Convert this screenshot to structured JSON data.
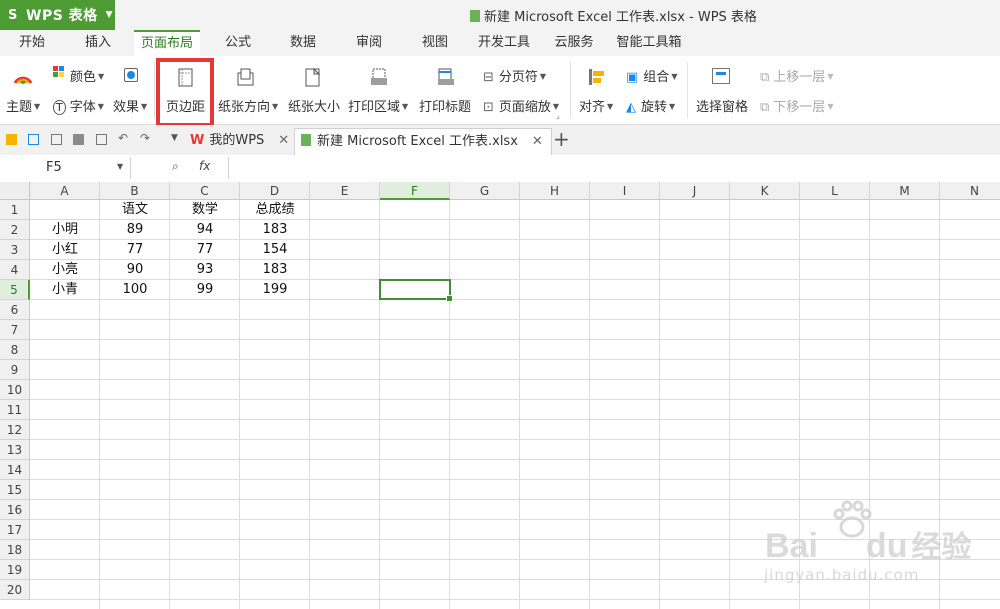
{
  "app": {
    "name": "WPS 表格",
    "logo": "S"
  },
  "window_title": "新建 Microsoft Excel 工作表.xlsx - WPS 表格",
  "menu_tabs": [
    "开始",
    "插入",
    "页面布局",
    "公式",
    "数据",
    "审阅",
    "视图",
    "开发工具",
    "云服务",
    "智能工具箱"
  ],
  "active_tab": "页面布局",
  "ribbon": {
    "theme": "主题",
    "colors": "颜色",
    "fonts": "字体",
    "effects": "效果",
    "margins": "页边距",
    "orientation": "纸张方向",
    "size": "纸张大小",
    "print_area": "打印区域",
    "print_titles": "打印标题",
    "breaks": "分页符",
    "scale": "页面缩放",
    "align": "对齐",
    "group": "组合",
    "rotate": "旋转",
    "selection_pane": "选择窗格",
    "bring_forward": "上移一层",
    "send_backward": "下移一层"
  },
  "doc_tabs": {
    "home": "我的WPS",
    "file": "新建 Microsoft Excel 工作表.xlsx",
    "add": "+"
  },
  "formula_bar": {
    "name_box": "F5",
    "fx": "fx",
    "value": ""
  },
  "columns": [
    "A",
    "B",
    "C",
    "D",
    "E",
    "F",
    "G",
    "H",
    "I",
    "J",
    "K",
    "L",
    "M",
    "N"
  ],
  "rows": [
    "1",
    "2",
    "3",
    "4",
    "5",
    "6",
    "7",
    "8",
    "9",
    "10",
    "11",
    "12",
    "13",
    "14",
    "15",
    "16",
    "17",
    "18",
    "19",
    "20"
  ],
  "selected": {
    "column": "F",
    "row": "5"
  },
  "sheet": {
    "header": [
      "",
      "语文",
      "数学",
      "总成绩"
    ],
    "records": [
      [
        "小明",
        "89",
        "94",
        "183"
      ],
      [
        "小红",
        "77",
        "77",
        "154"
      ],
      [
        "小亮",
        "90",
        "93",
        "183"
      ],
      [
        "小青",
        "100",
        "99",
        "199"
      ]
    ]
  },
  "watermark": {
    "brand": "Bai",
    "brand2": "du",
    "brand_cn": "经验",
    "url": "jingyan.baidu.com"
  },
  "colors": {
    "accent": "#4c9b33",
    "highlight": "#e53935"
  }
}
